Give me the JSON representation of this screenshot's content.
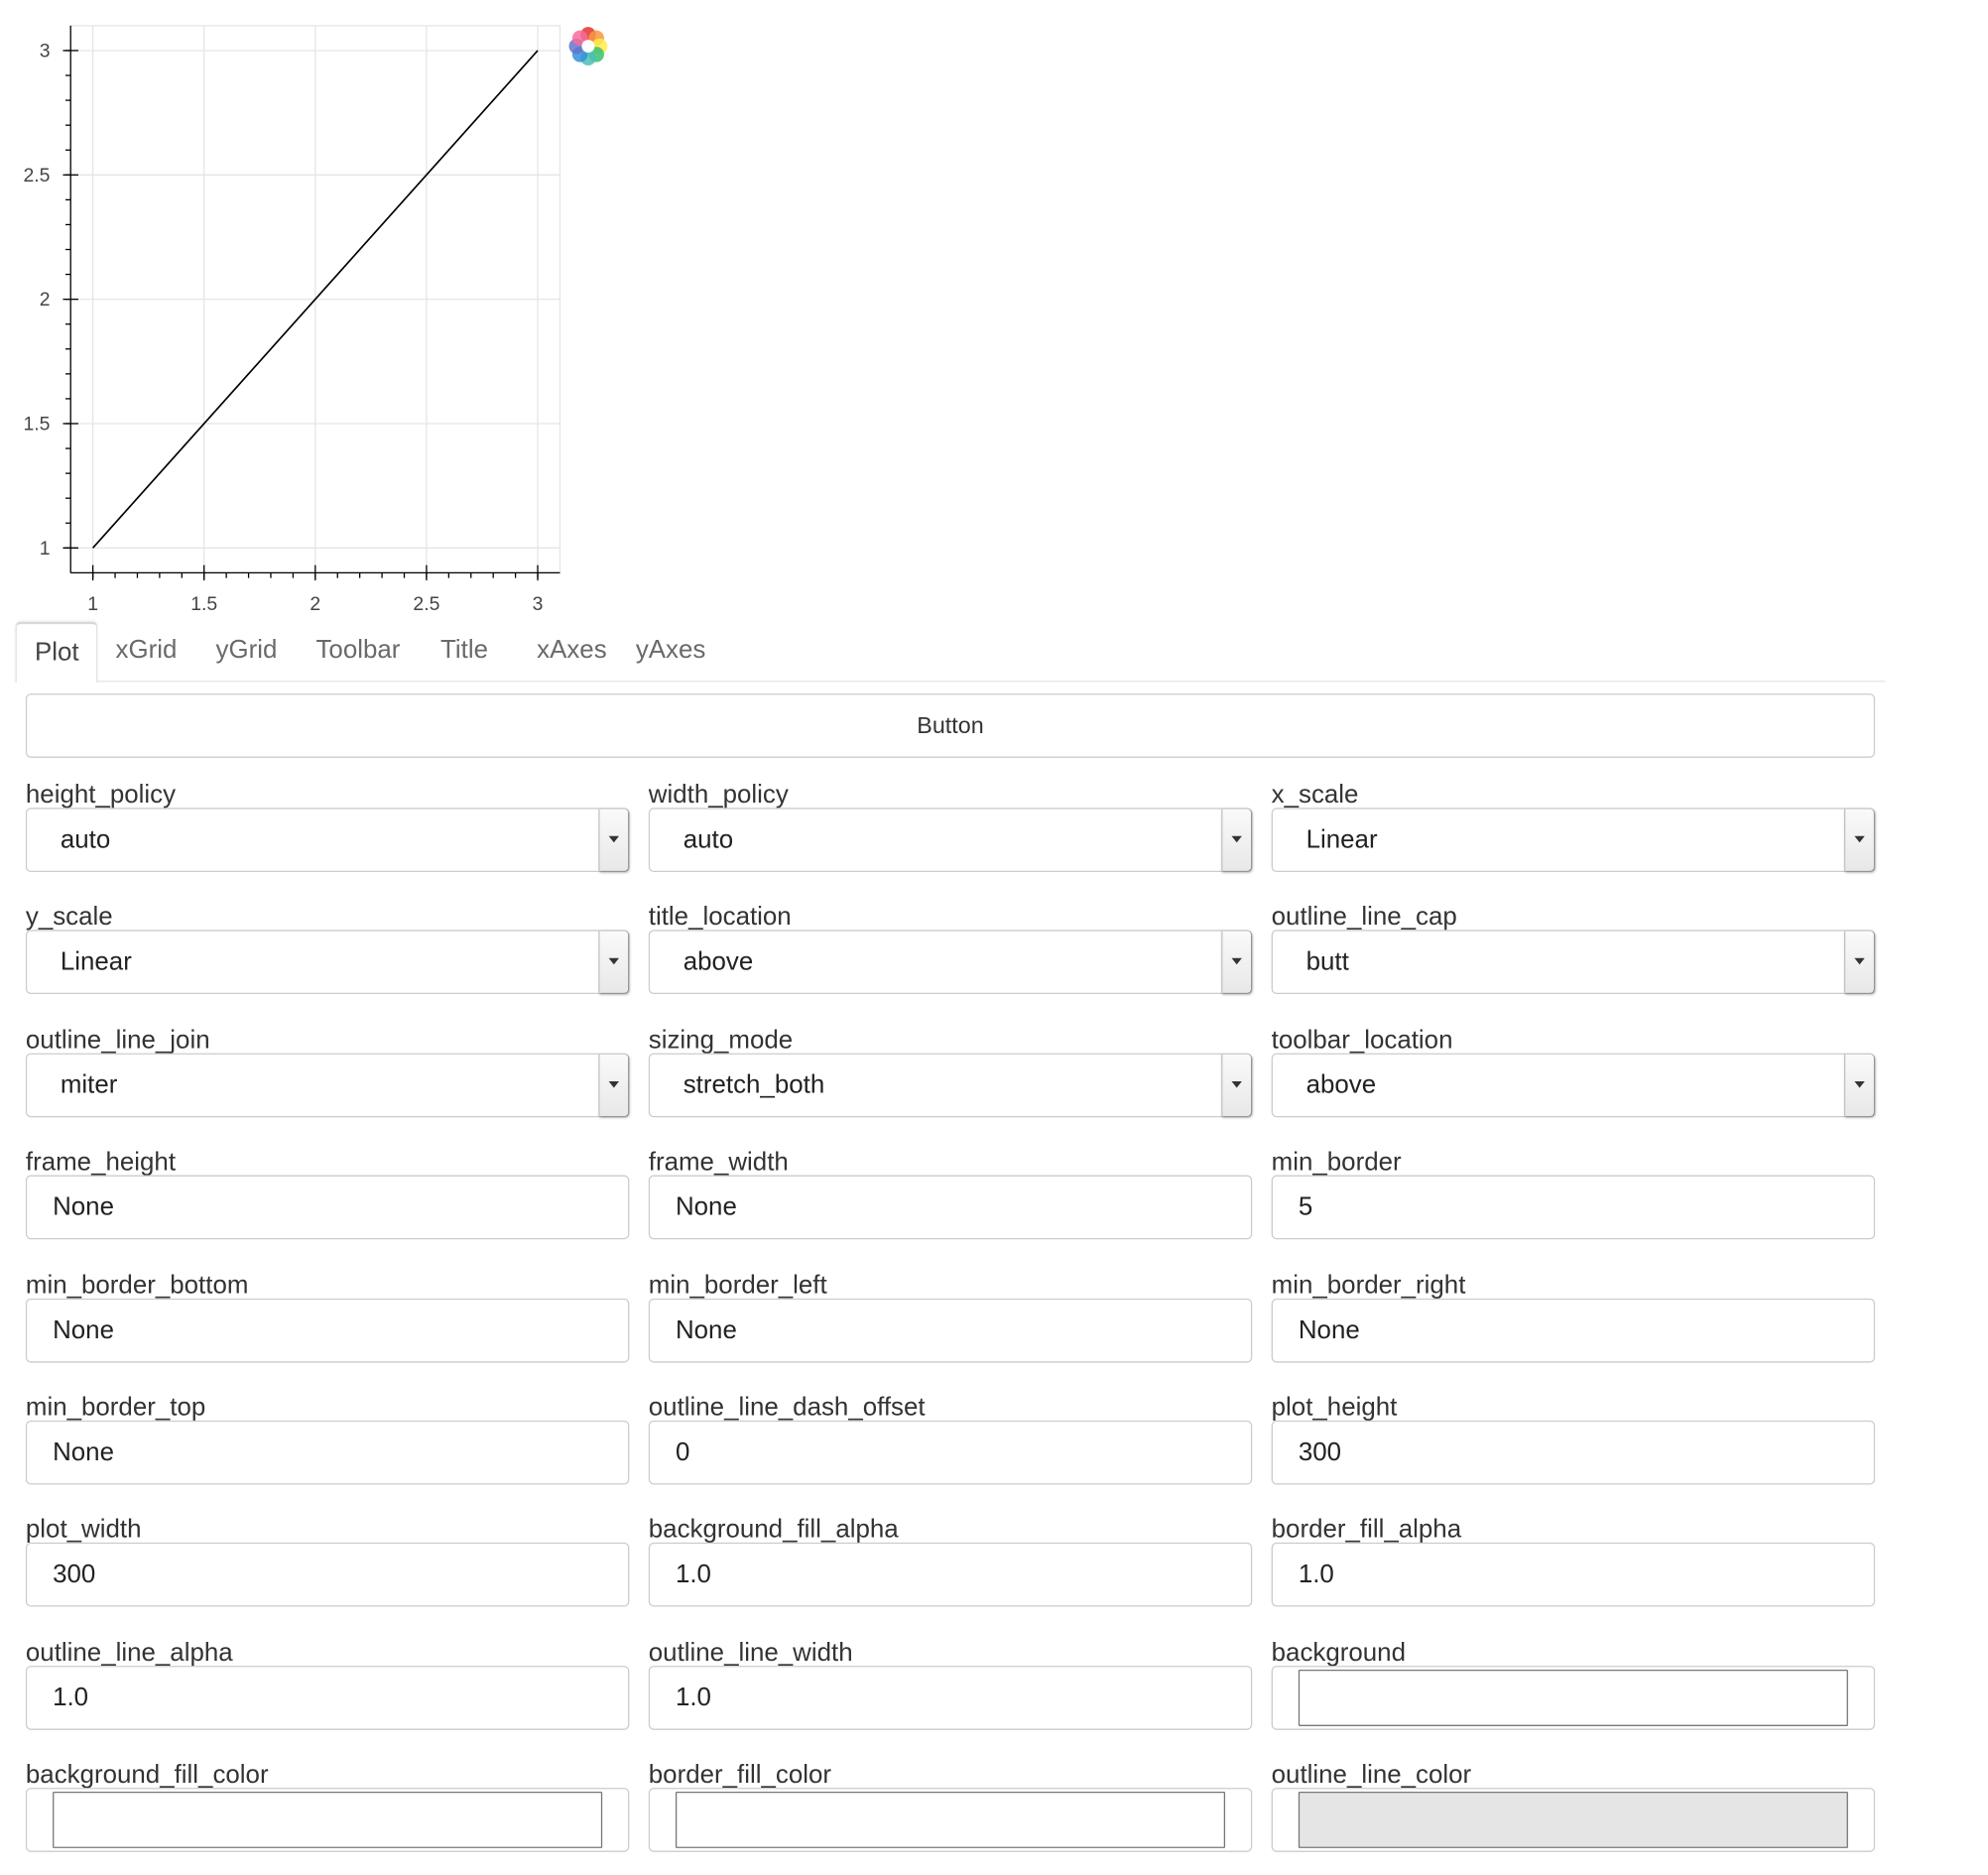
{
  "chart_data": {
    "type": "line",
    "x": [
      1,
      3
    ],
    "y": [
      1,
      3
    ],
    "series": [
      {
        "values": [
          1,
          3
        ]
      }
    ],
    "xlim": [
      0.9,
      3.1
    ],
    "ylim": [
      0.9,
      3.1
    ],
    "xticks": [
      "1",
      "1.5",
      "2",
      "2.5",
      "3"
    ],
    "yticks": [
      "1",
      "1.5",
      "2",
      "2.5",
      "3"
    ],
    "grid": true,
    "line_color": "#000000"
  },
  "toolbar": {
    "logo_icon": "bokeh-logo-icon"
  },
  "tabs": [
    {
      "label": "Plot",
      "active": true
    },
    {
      "label": "xGrid"
    },
    {
      "label": "yGrid"
    },
    {
      "label": "Toolbar"
    },
    {
      "label": "Title"
    },
    {
      "label": "xAxes"
    },
    {
      "label": "yAxes"
    }
  ],
  "button": {
    "label": "Button"
  },
  "fields": [
    {
      "id": "height-policy",
      "label": "height_policy",
      "type": "select",
      "value": "auto"
    },
    {
      "id": "width-policy",
      "label": "width_policy",
      "type": "select",
      "value": "auto"
    },
    {
      "id": "x-scale",
      "label": "x_scale",
      "type": "select",
      "value": "Linear"
    },
    {
      "id": "y-scale",
      "label": "y_scale",
      "type": "select",
      "value": "Linear"
    },
    {
      "id": "title-location",
      "label": "title_location",
      "type": "select",
      "value": "above"
    },
    {
      "id": "outline-line-cap",
      "label": "outline_line_cap",
      "type": "select",
      "value": "butt"
    },
    {
      "id": "outline-line-join",
      "label": "outline_line_join",
      "type": "select",
      "value": "miter"
    },
    {
      "id": "sizing-mode",
      "label": "sizing_mode",
      "type": "select",
      "value": "stretch_both"
    },
    {
      "id": "toolbar-location",
      "label": "toolbar_location",
      "type": "select",
      "value": "above"
    },
    {
      "id": "frame-height",
      "label": "frame_height",
      "type": "text",
      "value": "None"
    },
    {
      "id": "frame-width",
      "label": "frame_width",
      "type": "text",
      "value": "None"
    },
    {
      "id": "min-border",
      "label": "min_border",
      "type": "text",
      "value": "5"
    },
    {
      "id": "min-border-bottom",
      "label": "min_border_bottom",
      "type": "text",
      "value": "None"
    },
    {
      "id": "min-border-left",
      "label": "min_border_left",
      "type": "text",
      "value": "None"
    },
    {
      "id": "min-border-right",
      "label": "min_border_right",
      "type": "text",
      "value": "None"
    },
    {
      "id": "min-border-top",
      "label": "min_border_top",
      "type": "text",
      "value": "None"
    },
    {
      "id": "outline-line-dash-offset",
      "label": "outline_line_dash_offset",
      "type": "text",
      "value": "0"
    },
    {
      "id": "plot-height",
      "label": "plot_height",
      "type": "text",
      "value": "300"
    },
    {
      "id": "plot-width",
      "label": "plot_width",
      "type": "text",
      "value": "300"
    },
    {
      "id": "background-fill-alpha",
      "label": "background_fill_alpha",
      "type": "text",
      "value": "1.0"
    },
    {
      "id": "border-fill-alpha",
      "label": "border_fill_alpha",
      "type": "text",
      "value": "1.0"
    },
    {
      "id": "outline-line-alpha",
      "label": "outline_line_alpha",
      "type": "text",
      "value": "1.0"
    },
    {
      "id": "outline-line-width",
      "label": "outline_line_width",
      "type": "text",
      "value": "1.0"
    },
    {
      "id": "background",
      "label": "background",
      "type": "color",
      "value": "#ffffff"
    },
    {
      "id": "background-fill-color",
      "label": "background_fill_color",
      "type": "color",
      "value": "#ffffff"
    },
    {
      "id": "border-fill-color",
      "label": "border_fill_color",
      "type": "color",
      "value": "#ffffff"
    },
    {
      "id": "outline-line-color",
      "label": "outline_line_color",
      "type": "color",
      "value": "#e5e5e5"
    }
  ]
}
